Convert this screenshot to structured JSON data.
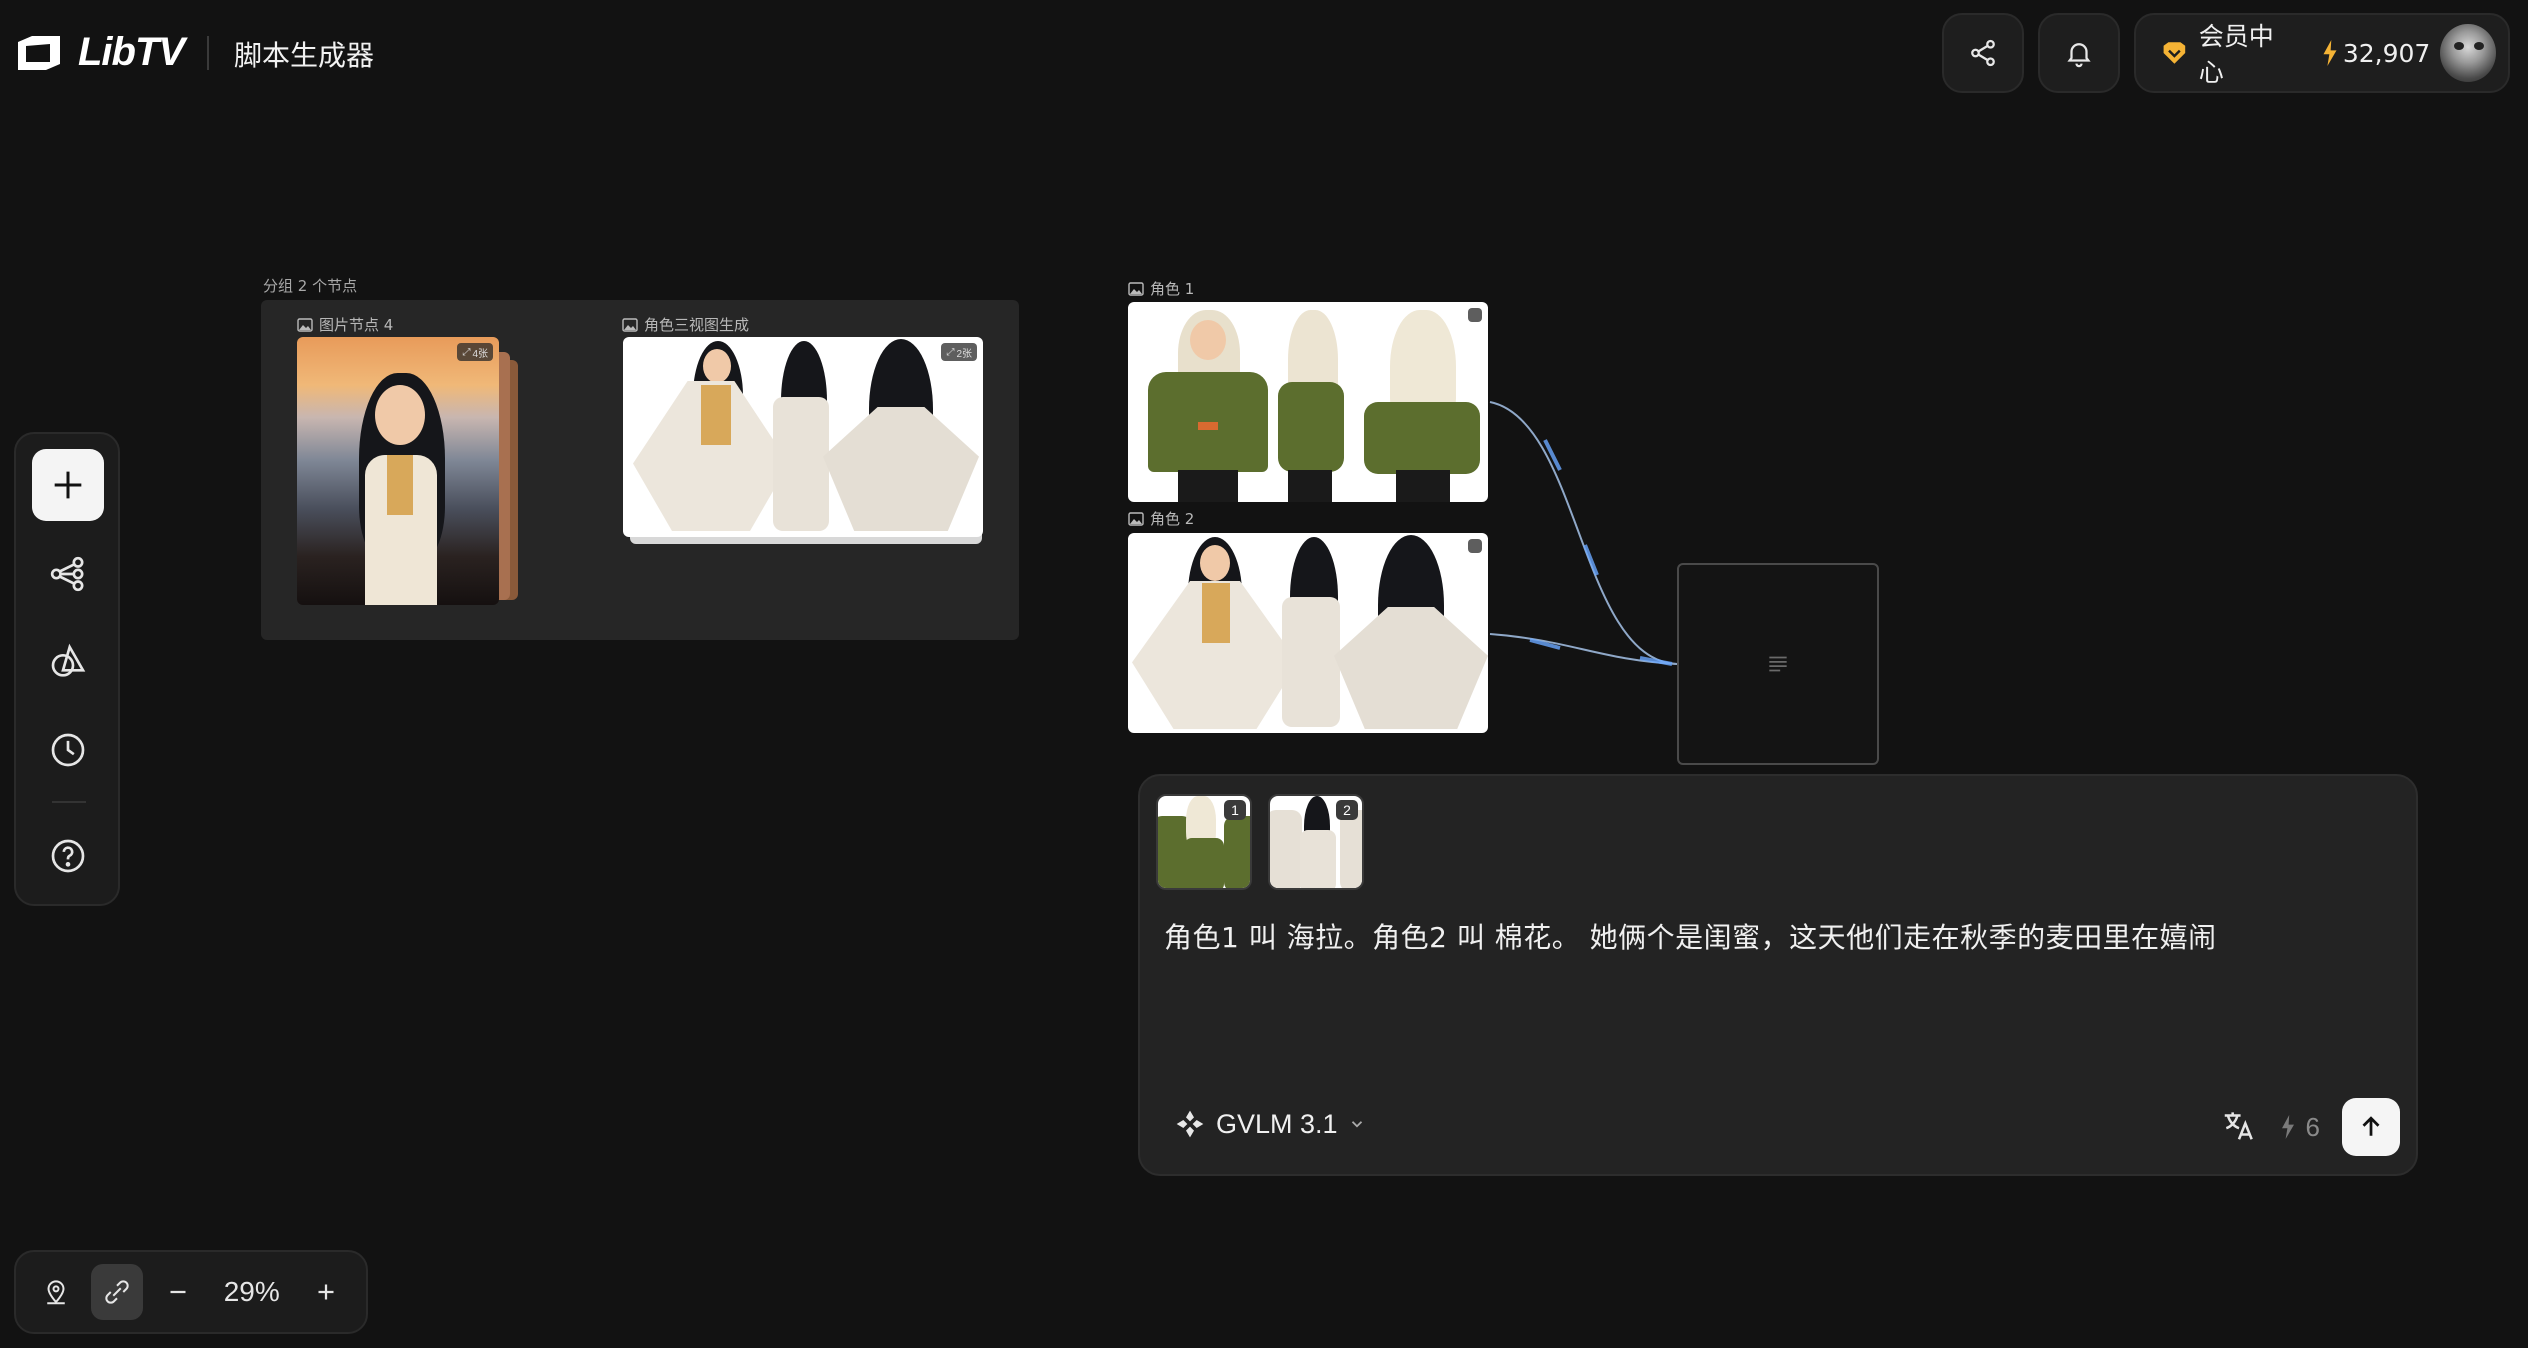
{
  "app": {
    "brand": "LibTV",
    "title": "脚本生成器"
  },
  "header": {
    "share_icon": "share-icon",
    "bell_icon": "bell-icon",
    "vip_label": "会员中心",
    "credits": "32,907"
  },
  "toolbar": {
    "items": [
      "add-icon",
      "workflow-icon",
      "shapes-icon",
      "history-icon",
      "help-icon"
    ]
  },
  "zoom": {
    "value": "29%"
  },
  "canvas": {
    "group_label": "分组 2 个节点",
    "image_node_label": "图片节点 4",
    "image_node_badge": "4张",
    "threeview_node_label": "角色三视图生成",
    "threeview_node_badge": "2张",
    "role1_label": "角色 1",
    "role2_label": "角色 2"
  },
  "prompt": {
    "thumb1_num": "1",
    "thumb2_num": "2",
    "text": "角色1 叫 海拉。角色2 叫 棉花。  她俩个是闺蜜，这天他们走在秋季的麦田里在嬉闹",
    "model": "GVLM 3.1",
    "cost": "6"
  },
  "colors": {
    "background": "#121212",
    "panel": "#232323",
    "accent_link": "#6aa8ff",
    "vip_gold": "#f5b335"
  }
}
